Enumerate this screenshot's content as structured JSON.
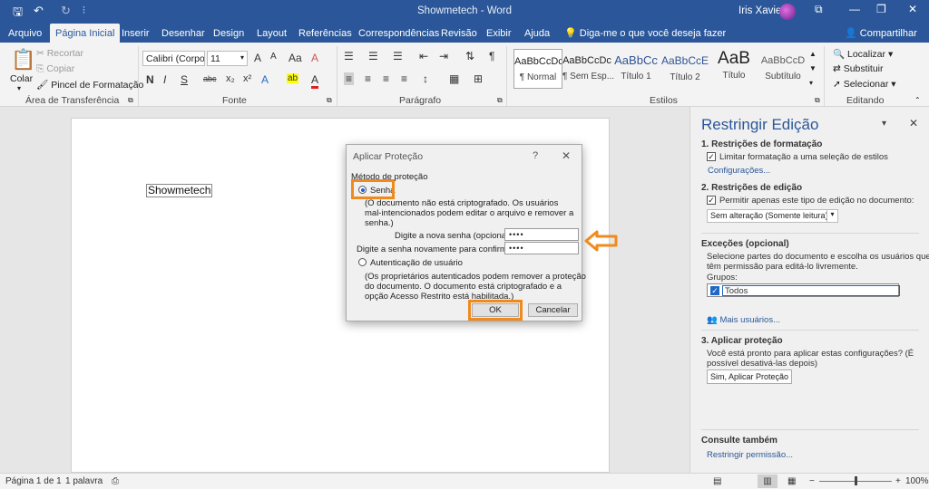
{
  "window": {
    "title": "Showmetech - Word",
    "user": "Iris Xavier",
    "quick_access": {
      "save": "🖫",
      "undo": "↶",
      "redo": "↻",
      "customize": "⫶"
    },
    "controls": {
      "ribbon_display": "⧉",
      "minimize": "—",
      "restore": "❐",
      "close": "✕"
    }
  },
  "tabs": [
    "Arquivo",
    "Página Inicial",
    "Inserir",
    "Desenhar",
    "Design",
    "Layout",
    "Referências",
    "Correspondências",
    "Revisão",
    "Exibir",
    "Ajuda"
  ],
  "tell_me": "Diga-me o que você deseja fazer",
  "share": "Compartilhar",
  "ribbon": {
    "clipboard": {
      "paste": "Colar",
      "cut": "Recortar",
      "copy": "Copiar",
      "format_painter": "Pincel de Formatação",
      "label": "Área de Transferência"
    },
    "font": {
      "name": "Calibri (Corpo",
      "size": "11",
      "label": "Fonte",
      "row1": [
        "A",
        "A",
        "Aa",
        "A"
      ],
      "bold": "N",
      "italic": "I",
      "underline": "S",
      "row2": [
        "abc",
        "x₂",
        "x²",
        "A",
        "ab",
        "A"
      ]
    },
    "paragraph": {
      "label": "Parágrafo",
      "row1": [
        "☰",
        "☰",
        "☰",
        "⇤",
        "⇥",
        "⇅",
        "¶"
      ],
      "row2": [
        "≡",
        "≡",
        "≡",
        "≡",
        "↕",
        "▦",
        "⊞"
      ]
    },
    "styles": {
      "label": "Estilos",
      "items": [
        {
          "preview": "AaBbCcDc",
          "name": "¶ Normal"
        },
        {
          "preview": "AaBbCcDc",
          "name": "¶ Sem Esp..."
        },
        {
          "preview": "AaBbCc",
          "name": "Título 1"
        },
        {
          "preview": "AaBbCcE",
          "name": "Título 2"
        },
        {
          "preview": "AaB",
          "name": "Título"
        },
        {
          "preview": "AaBbCcD",
          "name": "Subtítulo"
        }
      ]
    },
    "editing": {
      "label": "Editando",
      "find": "Localizar",
      "replace": "Substituir",
      "select": "Selecionar"
    }
  },
  "document": {
    "text": "Showmetech"
  },
  "dialog": {
    "title": "Aplicar Proteção",
    "help": "?",
    "close": "✕",
    "method_label": "Método de proteção",
    "password_option": "Senha",
    "password_desc": [
      "(O documento não está criptografado. Os usuários",
      "mal-intencionados podem editar o arquivo e remover a",
      "senha.)"
    ],
    "new_password_label": "Digite a nova senha (opcional):",
    "new_password_value": "••••",
    "confirm_password_label": "Digite a senha novamente para confirmar:",
    "confirm_password_value": "••••",
    "user_auth_option": "Autenticação de usuário",
    "user_auth_desc": [
      "(Os proprietários autenticados podem remover a proteção",
      "do documento. O documento está criptografado e a",
      "opção Acesso Restrito está habilitada.)"
    ],
    "ok": "OK",
    "cancel": "Cancelar"
  },
  "pane": {
    "title": "Restringir Edição",
    "section1_title": "1. Restrições de formatação",
    "section1_check": "Limitar formatação a uma seleção de estilos",
    "section1_link": "Configurações...",
    "section2_title": "2. Restrições de edição",
    "section2_check": "Permitir apenas este tipo de edição no documento:",
    "section2_select": "Sem alteração (Somente leitura)",
    "exceptions_title": "Exceções (opcional)",
    "exceptions_desc": [
      "Selecione partes do documento e escolha os usuários que",
      "têm permissão para editá-lo livremente."
    ],
    "groups_label": "Grupos:",
    "group_item": "Todos",
    "more_users": "Mais usuários...",
    "section3_title": "3. Aplicar proteção",
    "section3_desc": [
      "Você está pronto para aplicar estas configurações? (É",
      "possível desativá-las depois)"
    ],
    "apply_button": "Sim, Aplicar Proteção",
    "see_also": "Consulte também",
    "restrict_permission": "Restringir permissão..."
  },
  "status": {
    "page": "Página 1 de 1",
    "words": "1 palavra",
    "zoom": "100%",
    "zoom_minus": "−",
    "zoom_plus": "+",
    "zoom_level": 0.5
  },
  "colors": {
    "accent": "#2b579a",
    "highlight": "#f08a1c"
  }
}
